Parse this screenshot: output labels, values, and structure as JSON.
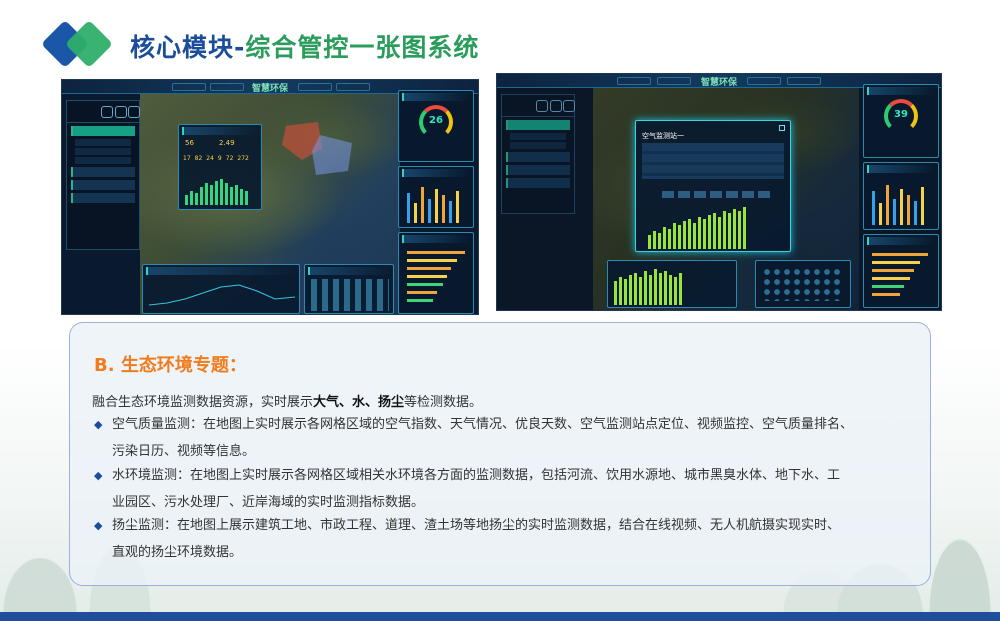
{
  "header": {
    "title_part1": "核心模块-",
    "title_part2": "综合管控一张图系统"
  },
  "screenshots": {
    "brand": "智慧环保",
    "left_aqi": "26",
    "right_aqi": "39",
    "left_metrics": [
      "17",
      "82",
      "24",
      "9",
      "72",
      "272"
    ],
    "left_primary": "56",
    "left_secondary": "2.49",
    "popup_title": "空气监测站一"
  },
  "section": {
    "title": "B. 生态环境专题：",
    "intro_pre": "融合生态环境监测数据资源，实时展示",
    "intro_bold": "大气、水、扬尘",
    "intro_post": "等检测数据。",
    "bullets": [
      {
        "line1": "空气质量监测：在地图上实时展示各网格区域的空气指数、天气情况、优良天数、空气监测站点定位、视频监控、空气质量排名、",
        "line2": "污染日历、视频等信息。"
      },
      {
        "line1": "水环境监测：在地图上实时展示各网格区域相关水环境各方面的监测数据，包括河流、饮用水源地、城市黑臭水体、地下水、工",
        "line2": "业园区、污水处理厂、近岸海域的实时监测指标数据。"
      },
      {
        "line1": "扬尘监测：在地图上展示建筑工地、市政工程、道理、渣土场等地扬尘的实时监测数据，结合在线视频、无人机航摄实现实时、",
        "line2": "直观的扬尘环境数据。"
      }
    ],
    "bullet_marker": "◆"
  }
}
